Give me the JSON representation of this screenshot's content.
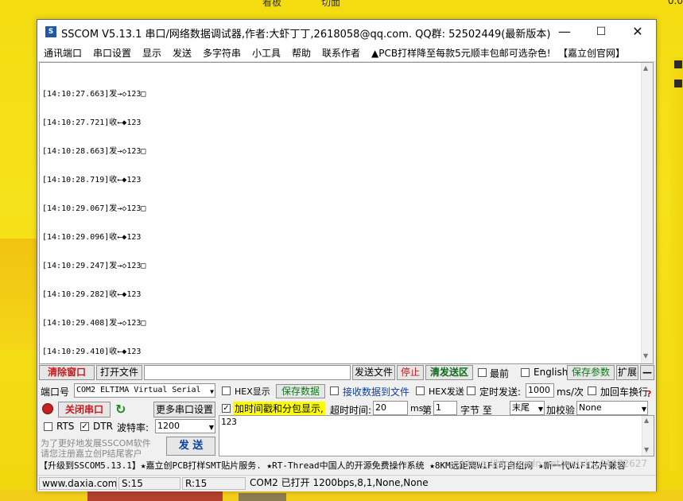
{
  "desktop": {
    "top_texts": [
      "看板",
      "切面"
    ],
    "top_right": "0.0"
  },
  "window": {
    "title": "SSCOM V5.13.1 串口/网络数据调试器,作者:大虾丁丁,2618058@qq.com. QQ群: 52502449(最新版本)",
    "app_icon": "S",
    "controls": {
      "minimize": "—",
      "maximize": "☐",
      "close": "✕"
    }
  },
  "menu": {
    "items": [
      "通讯端口",
      "串口设置",
      "显示",
      "发送",
      "多字符串",
      "小工具",
      "帮助",
      "联系作者",
      "▲PCB打样降至每款5元顺丰包邮可选杂色!",
      "【嘉立创官网】"
    ]
  },
  "receive": {
    "lines": [
      "[14:10:27.663]发→◇123□",
      "[14:10:27.721]收←◆123",
      "[14:10:28.663]发→◇123□",
      "[14:10:28.719]收←◆123",
      "[14:10:29.067]发→◇123□",
      "[14:10:29.096]收←◆123",
      "[14:10:29.247]发→◇123□",
      "[14:10:29.282]收←◆123",
      "[14:10:29.408]发→◇123□",
      "[14:10:29.410]收←◆123"
    ]
  },
  "toolbar": {
    "clear_window": "清除窗口",
    "open_file": "打开文件",
    "file_path": "",
    "send_file": "发送文件",
    "stop": "停止",
    "clear_send": "清发送区",
    "topmost": "最前",
    "english": "English",
    "save_params": "保存参数",
    "expand": "扩展",
    "collapse": "—"
  },
  "port": {
    "label": "端口号",
    "value": "COM2 ELTIMA Virtual Serial",
    "close_port": "关闭串口",
    "more_settings": "更多串口设置",
    "rts": "RTS",
    "dtr": "DTR",
    "baud_label": "波特率:",
    "baud_value": "1200",
    "promo1": "为了更好地发展SSCOM软件",
    "promo2": "请您注册嘉立创P结尾客户",
    "send": "发  送"
  },
  "options": {
    "hex_display": "HEX显示",
    "save_data": "保存数据",
    "recv_to_file": "接收数据到文件",
    "hex_send": "HEX发送",
    "timed_send": "定时发送:",
    "interval": "1000",
    "interval_unit": "ms/次",
    "add_crlf": "加回车换行",
    "timestamp": "加时间戳和分包显示,",
    "timeout_label": "超时时间:",
    "timeout_value": "20",
    "timeout_unit": "ms",
    "byte_prefix": "第",
    "byte_value": "1",
    "byte_mid": "字节 至",
    "byte_end": "末尾",
    "checksum_label": "加校验",
    "checksum_value": "None"
  },
  "send_area": {
    "text": "123"
  },
  "ticker": "【升级到SSCOM5.13.1】★嘉立创PCB打样SMT贴片服务. ★RT-Thread中国人的开源免费操作系统 ★8KM远距离WiFi可自组网 ★新一代WiFi芯片兼容",
  "status": {
    "website": "www.daxia.com",
    "sent": "S:15",
    "received": "R:15",
    "port_status": "COM2 已打开  1200bps,8,1,None,None",
    "watermark": "https://blog.csdn.net/weixin_44872627"
  }
}
